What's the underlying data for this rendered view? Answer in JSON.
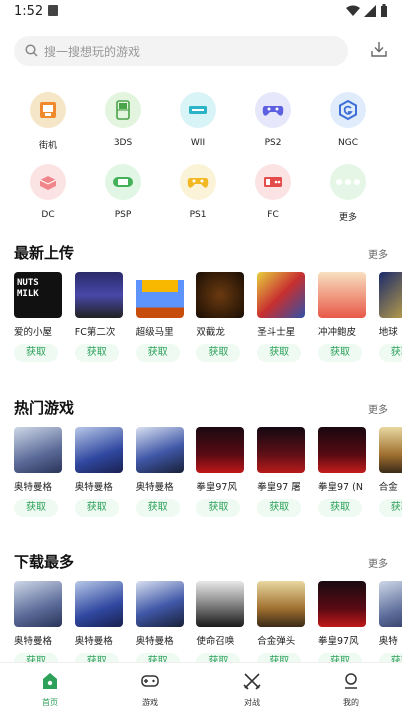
{
  "status_bar": {
    "time": "1:52",
    "notification_icon": "a-icon",
    "wifi_icon": "wifi-icon",
    "signal_icon": "signal-icon",
    "battery_icon": "battery-icon"
  },
  "search": {
    "placeholder": "搜一搜想玩的游戏",
    "icon": "search-icon"
  },
  "download_icon": "download-icon",
  "categories": [
    {
      "label": "街机",
      "color": "#f6e6c8",
      "icon": "arcade-icon"
    },
    {
      "label": "3DS",
      "color": "#e3f4df",
      "icon": "3ds-icon"
    },
    {
      "label": "WII",
      "color": "#d8f4f7",
      "icon": "wii-icon"
    },
    {
      "label": "PS2",
      "color": "#e7e7fb",
      "icon": "ps2-controller-icon"
    },
    {
      "label": "NGC",
      "color": "#e0ecfb",
      "icon": "ngc-icon"
    },
    {
      "label": "DC",
      "color": "#fbe3e3",
      "icon": "dc-icon"
    },
    {
      "label": "PSP",
      "color": "#e1f6e4",
      "icon": "psp-icon"
    },
    {
      "label": "PS1",
      "color": "#fbf3d8",
      "icon": "ps1-controller-icon"
    },
    {
      "label": "FC",
      "color": "#fbe3e3",
      "icon": "fc-icon"
    },
    {
      "label": "更多",
      "color": "#e5f6e6",
      "icon": "more-dots-icon"
    }
  ],
  "sections": [
    {
      "title": "最新上传",
      "more": "更多",
      "items": [
        {
          "name": "爱的小屋",
          "get": "获取",
          "thumb": "nuts-milk"
        },
        {
          "name": "FC第二次",
          "get": "获取",
          "thumb": "fc-second"
        },
        {
          "name": "超级马里",
          "get": "获取",
          "thumb": "mario"
        },
        {
          "name": "双截龙",
          "get": "获取",
          "thumb": "double-dragon"
        },
        {
          "name": "圣斗士星",
          "get": "获取",
          "thumb": "saint-seiya"
        },
        {
          "name": "冲冲鲍皮",
          "get": "获取",
          "thumb": "chongchong"
        },
        {
          "name": "地球",
          "get": "获取",
          "thumb": "earth"
        }
      ]
    },
    {
      "title": "热门游戏",
      "more": "更多",
      "items": [
        {
          "name": "奥特曼格",
          "get": "获取",
          "thumb": "ultraman-1"
        },
        {
          "name": "奥特曼格",
          "get": "获取",
          "thumb": "ultraman-2"
        },
        {
          "name": "奥特曼格",
          "get": "获取",
          "thumb": "ultraman-3"
        },
        {
          "name": "拳皇97风",
          "get": "获取",
          "thumb": "kof97-1"
        },
        {
          "name": "拳皇97 屠",
          "get": "获取",
          "thumb": "kof97-2"
        },
        {
          "name": "拳皇97 (N",
          "get": "获取",
          "thumb": "kof97-3"
        },
        {
          "name": "合金",
          "get": "获取",
          "thumb": "metal-slug"
        }
      ]
    },
    {
      "title": "下载最多",
      "more": "更多",
      "items": [
        {
          "name": "奥特曼格",
          "get": "获取",
          "thumb": "ultraman-1"
        },
        {
          "name": "奥特曼格",
          "get": "获取",
          "thumb": "ultraman-2"
        },
        {
          "name": "奥特曼格",
          "get": "获取",
          "thumb": "ultraman-3"
        },
        {
          "name": "使命召唤",
          "get": "获取",
          "thumb": "cod"
        },
        {
          "name": "合金弹头",
          "get": "获取",
          "thumb": "metal-slug"
        },
        {
          "name": "拳皇97风",
          "get": "获取",
          "thumb": "kof97-1"
        },
        {
          "name": "奥特",
          "get": "获取",
          "thumb": "ultraman-1"
        }
      ]
    }
  ],
  "tabs": [
    {
      "label": "首页",
      "icon": "home-icon",
      "active": true
    },
    {
      "label": "游戏",
      "icon": "gamepad-icon",
      "active": false
    },
    {
      "label": "对战",
      "icon": "swords-icon",
      "active": false
    },
    {
      "label": "我的",
      "icon": "profile-icon",
      "active": false
    }
  ],
  "colors": {
    "accent": "#2da15a",
    "get_bg": "#eefaf2"
  }
}
